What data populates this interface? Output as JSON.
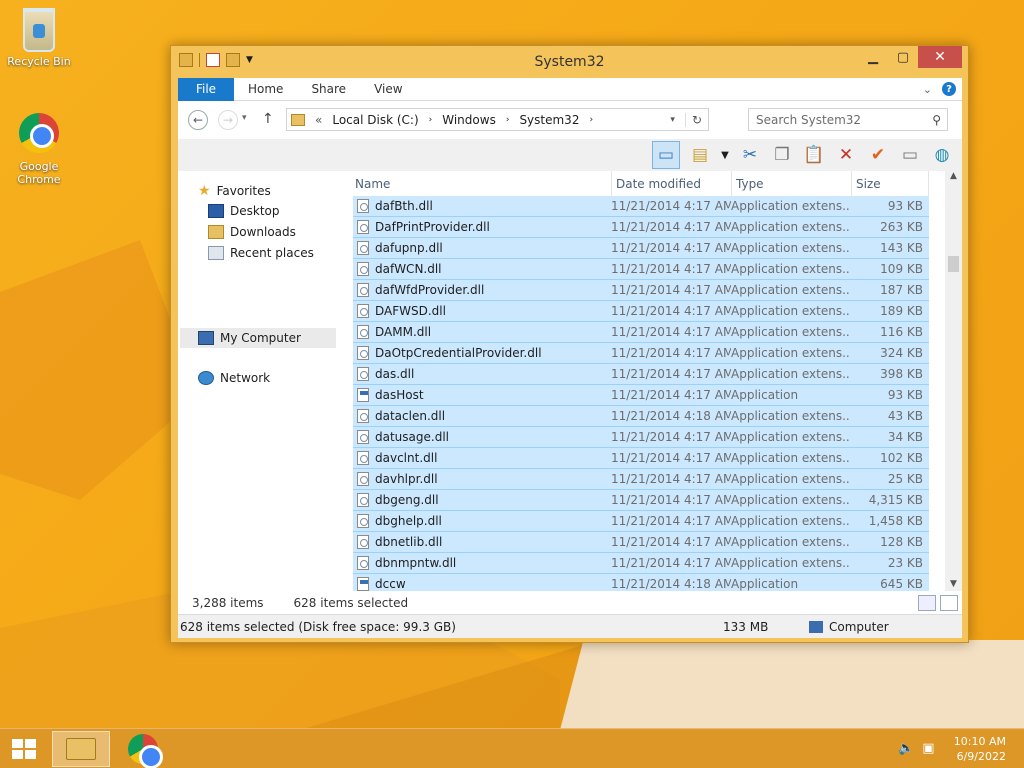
{
  "desktop": {
    "icons": [
      {
        "label": "Recycle Bin"
      },
      {
        "label": "Google Chrome"
      }
    ]
  },
  "window": {
    "title": "System32",
    "tabs": {
      "file": "File",
      "home": "Home",
      "share": "Share",
      "view": "View"
    },
    "address": {
      "prefix": "«",
      "crumbs": [
        "Local Disk (C:)",
        "Windows",
        "System32"
      ]
    },
    "search_placeholder": "Search System32",
    "nav": {
      "favorites": "Favorites",
      "desktop": "Desktop",
      "downloads": "Downloads",
      "recent": "Recent places",
      "computer": "My Computer",
      "network": "Network"
    },
    "columns": {
      "name": "Name",
      "date": "Date modified",
      "type": "Type",
      "size": "Size"
    },
    "files": [
      {
        "name": "dafBth.dll",
        "date": "11/21/2014 4:17 AM",
        "type": "Application extens...",
        "size": "93 KB",
        "icon": "dll"
      },
      {
        "name": "DafPrintProvider.dll",
        "date": "11/21/2014 4:17 AM",
        "type": "Application extens...",
        "size": "263 KB",
        "icon": "dll"
      },
      {
        "name": "dafupnp.dll",
        "date": "11/21/2014 4:17 AM",
        "type": "Application extens...",
        "size": "143 KB",
        "icon": "dll"
      },
      {
        "name": "dafWCN.dll",
        "date": "11/21/2014 4:17 AM",
        "type": "Application extens...",
        "size": "109 KB",
        "icon": "dll"
      },
      {
        "name": "dafWfdProvider.dll",
        "date": "11/21/2014 4:17 AM",
        "type": "Application extens...",
        "size": "187 KB",
        "icon": "dll"
      },
      {
        "name": "DAFWSD.dll",
        "date": "11/21/2014 4:17 AM",
        "type": "Application extens...",
        "size": "189 KB",
        "icon": "dll"
      },
      {
        "name": "DAMM.dll",
        "date": "11/21/2014 4:17 AM",
        "type": "Application extens...",
        "size": "116 KB",
        "icon": "dll"
      },
      {
        "name": "DaOtpCredentialProvider.dll",
        "date": "11/21/2014 4:17 AM",
        "type": "Application extens...",
        "size": "324 KB",
        "icon": "dll"
      },
      {
        "name": "das.dll",
        "date": "11/21/2014 4:17 AM",
        "type": "Application extens...",
        "size": "398 KB",
        "icon": "dll"
      },
      {
        "name": "dasHost",
        "date": "11/21/2014 4:17 AM",
        "type": "Application",
        "size": "93 KB",
        "icon": "app"
      },
      {
        "name": "dataclen.dll",
        "date": "11/21/2014 4:18 AM",
        "type": "Application extens...",
        "size": "43 KB",
        "icon": "dll"
      },
      {
        "name": "datusage.dll",
        "date": "11/21/2014 4:17 AM",
        "type": "Application extens...",
        "size": "34 KB",
        "icon": "dll"
      },
      {
        "name": "davclnt.dll",
        "date": "11/21/2014 4:17 AM",
        "type": "Application extens...",
        "size": "102 KB",
        "icon": "dll"
      },
      {
        "name": "davhlpr.dll",
        "date": "11/21/2014 4:17 AM",
        "type": "Application extens...",
        "size": "25 KB",
        "icon": "dll"
      },
      {
        "name": "dbgeng.dll",
        "date": "11/21/2014 4:17 AM",
        "type": "Application extens...",
        "size": "4,315 KB",
        "icon": "dll"
      },
      {
        "name": "dbghelp.dll",
        "date": "11/21/2014 4:17 AM",
        "type": "Application extens...",
        "size": "1,458 KB",
        "icon": "dll"
      },
      {
        "name": "dbnetlib.dll",
        "date": "11/21/2014 4:17 AM",
        "type": "Application extens...",
        "size": "128 KB",
        "icon": "dll"
      },
      {
        "name": "dbnmpntw.dll",
        "date": "11/21/2014 4:17 AM",
        "type": "Application extens...",
        "size": "23 KB",
        "icon": "dll"
      },
      {
        "name": "dccw",
        "date": "11/21/2014 4:18 AM",
        "type": "Application",
        "size": "645 KB",
        "icon": "app"
      }
    ],
    "status": {
      "item_count": "3,288 items",
      "selected": "628 items selected",
      "detail": "628 items selected (Disk free space: 99.3 GB)",
      "size": "133 MB",
      "location": "Computer"
    }
  },
  "taskbar": {
    "time": "10:10 AM",
    "date": "6/9/2022"
  },
  "colors": {
    "selection": "#cce8ff",
    "accent": "#1979ca",
    "close": "#c7504a"
  }
}
